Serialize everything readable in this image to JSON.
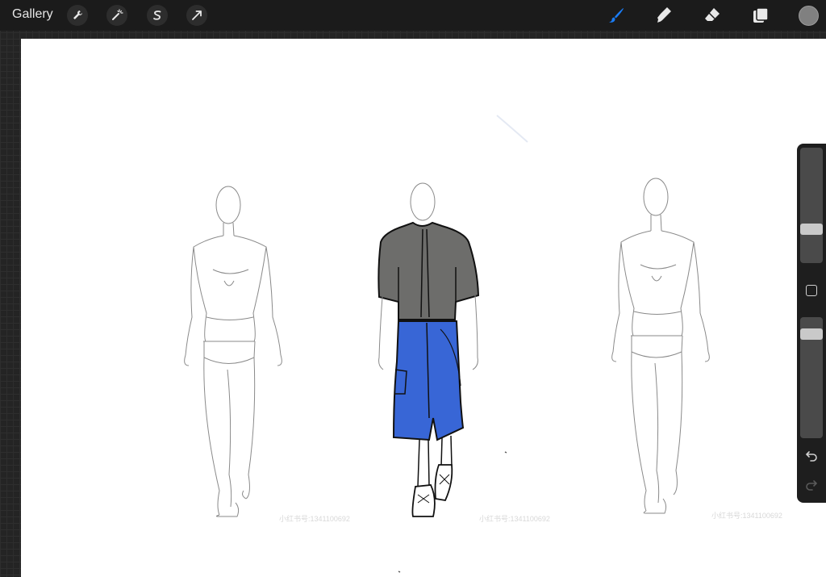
{
  "topbar": {
    "gallery_label": "Gallery",
    "left_tools": [
      {
        "name": "actions",
        "icon": "wrench-icon"
      },
      {
        "name": "adjustments",
        "icon": "magic-wand-icon"
      },
      {
        "name": "selection",
        "icon": "selection-s-icon"
      },
      {
        "name": "transform",
        "icon": "arrow-cursor-icon"
      }
    ],
    "right_tools": [
      {
        "name": "brush",
        "icon": "brush-icon",
        "active": true
      },
      {
        "name": "smudge",
        "icon": "smudge-icon"
      },
      {
        "name": "eraser",
        "icon": "eraser-icon"
      },
      {
        "name": "layers",
        "icon": "layers-icon"
      }
    ],
    "current_color": "#808080"
  },
  "sidebar": {
    "brush_size_level": 0.27,
    "opacity_level": 0.1,
    "icons": [
      "modify-square-icon",
      "undo-icon",
      "redo-icon"
    ]
  },
  "colors": {
    "accent": "#1a7cf5",
    "shirt": "#6d6d6b",
    "shorts": "#3866d6"
  },
  "watermarks": [
    "小红书号:1341100692",
    "小红书号:1341100692",
    "小红书号:1341100692"
  ]
}
